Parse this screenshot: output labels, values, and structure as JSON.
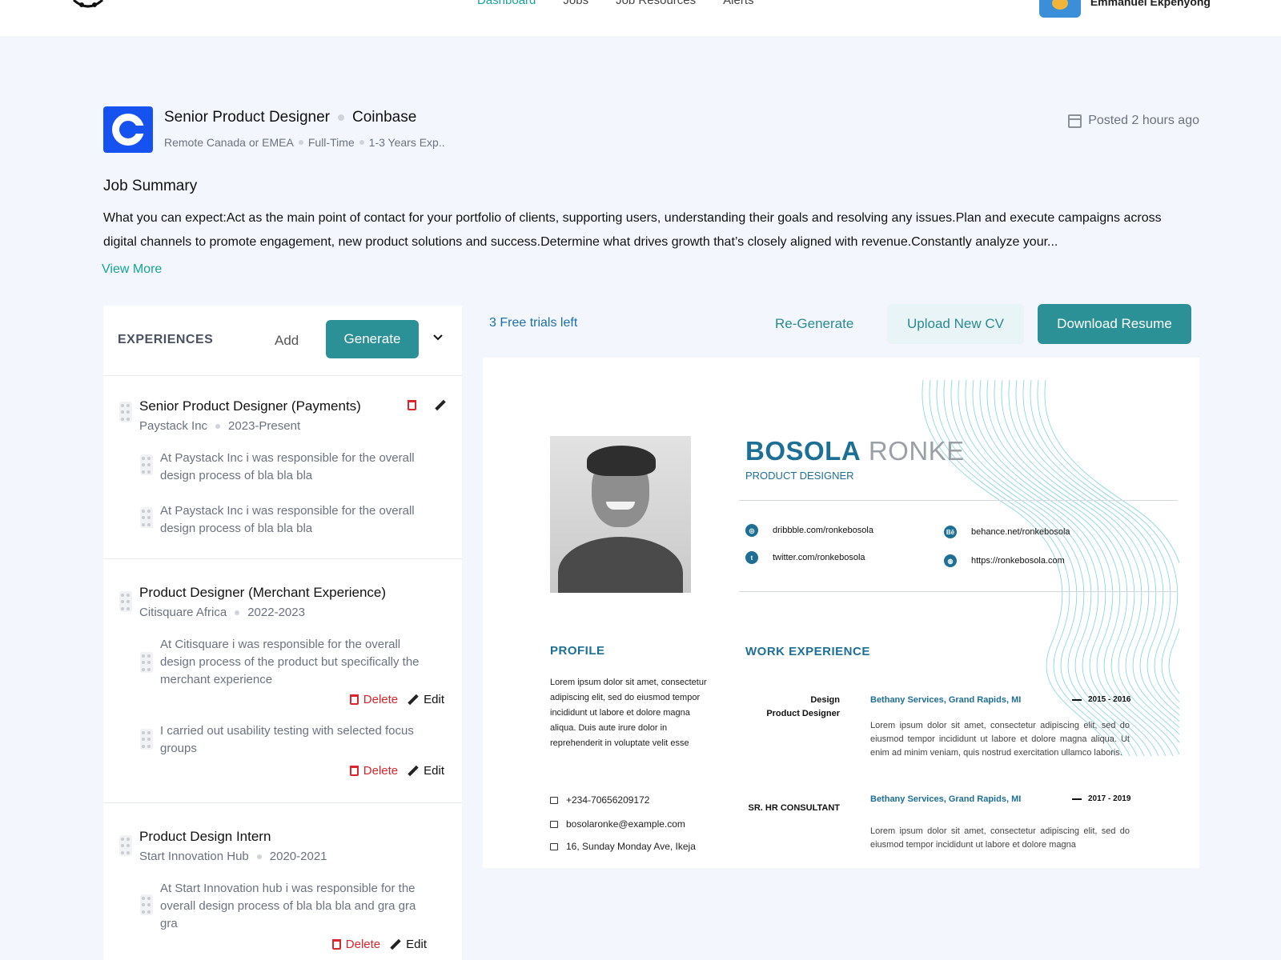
{
  "nav": {
    "items": [
      "Dashboard",
      "Jobs",
      "Job Resources",
      "Alerts"
    ],
    "user_name": "Emmanuel Ekpenyong"
  },
  "job": {
    "title": "Senior Product Designer",
    "company": "Coinbase",
    "location": "Remote Canada or EMEA",
    "type": "Full-Time",
    "experience": "1-3 Years Exp..",
    "posted": "Posted 2 hours ago",
    "summary_title": "Job Summary",
    "summary": "What you can expect:Act as the main point of contact for your portfolio of clients, supporting users, understanding their goals and resolving any issues.Plan and execute campaigns across digital channels to promote engagement, new product solutions and success.Determine what drives growth that’s closely aligned with revenue.Constantly analyze your...",
    "view_more": "View More"
  },
  "experiences": {
    "label": "EXPERIENCES",
    "add": "Add",
    "generate": "Generate",
    "items": [
      {
        "title": "Senior Product Designer (Payments)",
        "company": "Paystack Inc",
        "period": "2023-Present",
        "bullets": [
          "At Paystack Inc i was responsible for the overall design process of bla bla bla",
          "At Paystack Inc i was responsible for the overall design process of bla bla bla"
        ]
      },
      {
        "title": "Product Designer (Merchant Experience)",
        "company": "Citisquare Africa",
        "period": "2022-2023",
        "bullets": [
          "At Citisquare i was responsible for the overall design process of the product but specifically the merchant experience",
          "I carried out usability testing with selected focus groups"
        ]
      },
      {
        "title": "Product Design Intern",
        "company": "Start Innovation Hub",
        "period": "2020-2021",
        "bullets": [
          "At Start Innovation hub i was responsible for the overall design process of bla bla bla and gra gra gra"
        ]
      }
    ],
    "delete_label": "Delete",
    "edit_label": "Edit"
  },
  "toolbar": {
    "trials": "3 Free trials left",
    "regenerate": "Re-Generate",
    "upload": "Upload New CV",
    "download": "Download Resume"
  },
  "resume": {
    "first_name": "BOSOLA",
    "last_name": "RONKE",
    "role": "PRODUCT DESIGNER",
    "links": {
      "dribbble": "dribbble.com/ronkebosola",
      "behance": "behance.net/ronkebosola",
      "twitter": "twitter.com/ronkebosola",
      "website": "https://ronkebosola.com"
    },
    "profile_title": "PROFILE",
    "profile_text": "Lorem ipsum dolor sit amet, consectetur adipiscing elit, sed do eiusmod tempor incididunt ut labore et dolore magna aliqua. Duis aute irure dolor in reprehenderit in voluptate velit esse",
    "phone": "+234-70656209172",
    "email": "bosolaronke@example.com",
    "address": "16, Sunday Monday Ave, Ikeja",
    "work_title": "WORK EXPERIENCE",
    "jobs": [
      {
        "role_line1": "Design",
        "role_line2": "Product Designer",
        "company": "Bethany Services, Grand Rapids, MI",
        "years": "2015 - 2016",
        "desc": "Lorem ipsum dolor sit amet, consectetur adipiscing elit, sed do eiusmod tempor incididunt ut labore et dolore magna aliqua. Ut enim ad minim veniam, quis nostrud exercitation ullamco laboris."
      },
      {
        "role_line1": "SR. HR CONSULTANT",
        "company": "Bethany Services, Grand Rapids, MI",
        "years": "2017 - 2019",
        "desc": "Lorem ipsum dolor sit amet, consectetur adipiscing elit, sed do eiusmod tempor incididunt ut labore et dolore magna"
      }
    ]
  },
  "colors": {
    "accent": "#2b9196",
    "active_nav": "#16a39a",
    "brand_blue": "#1652f0",
    "resume_blue": "#1e6f96",
    "delete_red": "#d9252b"
  }
}
